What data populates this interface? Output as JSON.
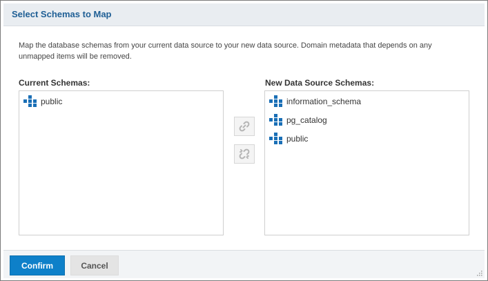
{
  "dialog": {
    "title": "Select Schemas to Map",
    "description": "Map the database schemas from your current data source to your new data source. Domain metadata that depends on any unmapped items will be removed."
  },
  "current_schemas": {
    "label": "Current Schemas:",
    "items": [
      {
        "label": "public",
        "icon": "schema-icon"
      }
    ]
  },
  "new_schemas": {
    "label": "New Data Source Schemas:",
    "items": [
      {
        "label": "information_schema",
        "icon": "schema-icon"
      },
      {
        "label": "pg_catalog",
        "icon": "schema-icon"
      },
      {
        "label": "public",
        "icon": "schema-icon"
      }
    ]
  },
  "mapping_buttons": {
    "link_icon": "link-icon",
    "unlink_icon": "unlink-icon"
  },
  "footer": {
    "confirm_label": "Confirm",
    "cancel_label": "Cancel"
  },
  "colors": {
    "title": "#1f5f95",
    "confirm_bg": "#0e80c9",
    "icon_blue": "#1a6fb6"
  }
}
